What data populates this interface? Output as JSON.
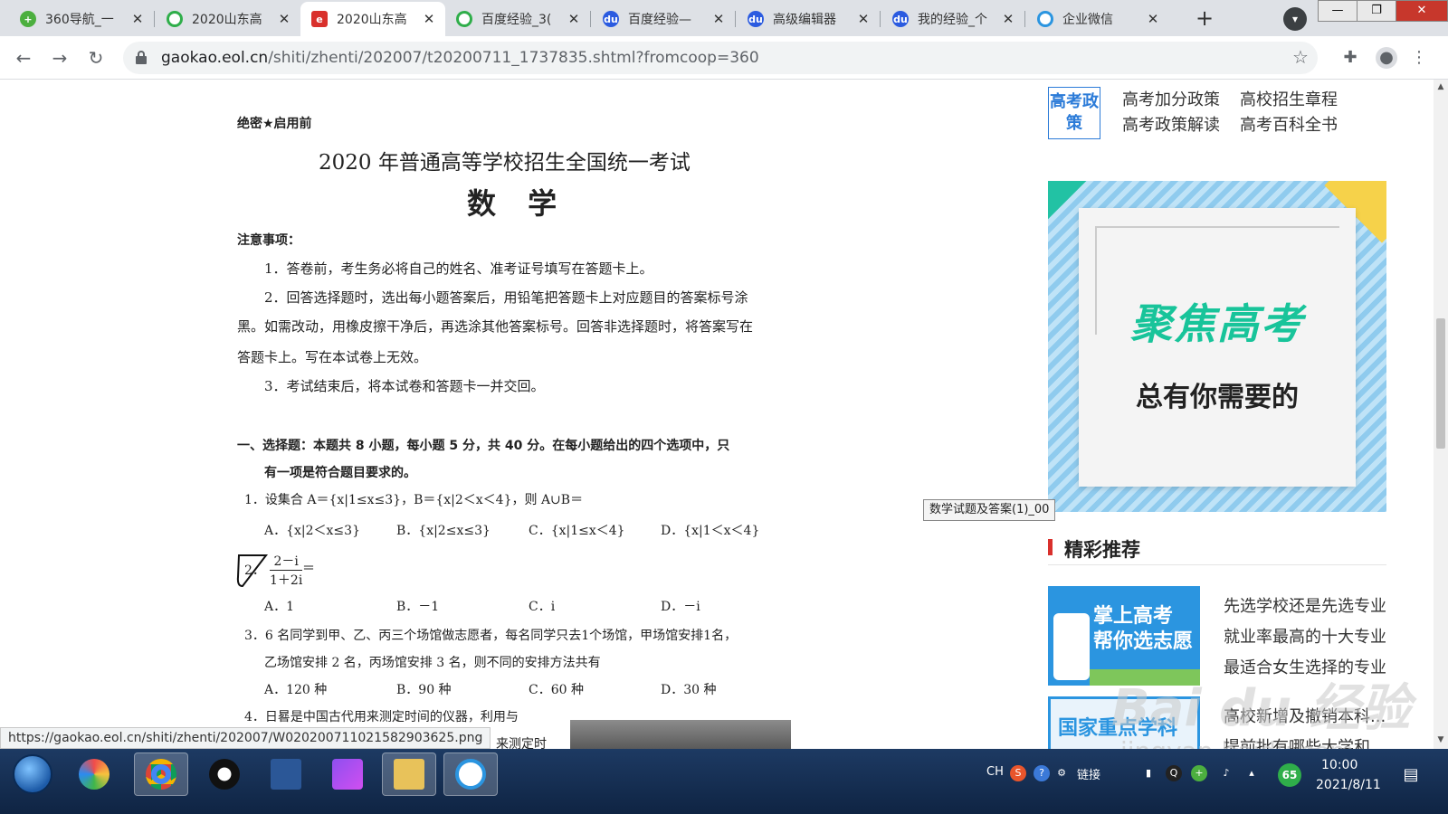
{
  "browser": {
    "tabs": [
      {
        "label": "360导航_一",
        "icon": "360",
        "color": "#4caf3f",
        "active": false
      },
      {
        "label": "2020山东高",
        "icon": "O",
        "color": "#2fae4a",
        "active": false
      },
      {
        "label": "2020山东高",
        "icon": "E",
        "color": "#d9302c",
        "active": true
      },
      {
        "label": "百度经验_3(",
        "icon": "O",
        "color": "#2fae4a",
        "active": false
      },
      {
        "label": "百度经验—",
        "icon": "du",
        "color": "#2b5be0",
        "active": false
      },
      {
        "label": "高级编辑器",
        "icon": "du",
        "color": "#2b5be0",
        "active": false
      },
      {
        "label": "我的经验_个",
        "icon": "du",
        "color": "#2b5be0",
        "active": false
      },
      {
        "label": "企业微信",
        "icon": "wx",
        "color": "#2b95e0",
        "active": false
      }
    ],
    "tab_close": "✕",
    "new_tab": "+",
    "url_host": "gaokao.eol.cn",
    "url_path": "/shiti/zhenti/202007/t20200711_1737835.shtml?fromcoop=360",
    "window_controls": {
      "minimize": "—",
      "maximize": "❐",
      "close": "✕"
    }
  },
  "paper": {
    "secret": "绝密★启用前",
    "title": "2020 年普通高等学校招生全国统一考试",
    "subject": "数 学",
    "notice_heading": "注意事项：",
    "notices": [
      "1．答卷前，考生务必将自己的姓名、准考证号填写在答题卡上。",
      "2．回答选择题时，选出每小题答案后，用铅笔把答题卡上对应题目的答案标号涂",
      "黑。如需改动，用橡皮擦干净后，再选涂其他答案标号。回答非选择题时，将答案写在",
      "答题卡上。写在本试卷上无效。",
      "3．考试结束后，将本试卷和答题卡一并交回。"
    ],
    "section1_line1": "一、选择题：本题共 8 小题，每小题 5 分，共 40 分。在每小题给出的四个选项中，只",
    "section1_line2": "有一项是符合题目要求的。",
    "q1": "1．设集合 A＝{x|1≤x≤3}，B＝{x|2＜x＜4}，则 A∪B＝",
    "q1_options": [
      "A．{x|2＜x≤3}",
      "B．{x|2≤x≤3}",
      "C．{x|1≤x＜4}",
      "D．{x|1＜x＜4}"
    ],
    "q2_number": "2．",
    "q2_num": "2－i",
    "q2_den": "1＋2i",
    "q2_eq": "＝",
    "q2_options": [
      "A．1",
      "B．－1",
      "C．i",
      "D．－i"
    ],
    "q3_line1": "3．6 名同学到甲、乙、丙三个场馆做志愿者，每名同学只去1个场馆，甲场馆安排1名，",
    "q3_line2": "乙场馆安排 2 名，丙场馆安排 3 名，则不同的安排方法共有",
    "q3_options": [
      "A．120 种",
      "B．90 种",
      "C．60 种",
      "D．30 种"
    ],
    "q4_line1": "4．日晷是中国古代用来测定时间的仪器，利用与",
    "q4_line2": "来测定时"
  },
  "sidebar": {
    "policy_box": "高考政策",
    "policy_links": [
      "高考加分政策",
      "高校招生章程",
      "高考政策解读",
      "高考百科全书"
    ],
    "banner_title": "聚焦高考",
    "banner_sub": "总有你需要的",
    "tooltip": "数学试题及答案(1)_00",
    "rec_title": "精彩推荐",
    "promo1_text1": "掌上高考",
    "promo1_text2": "帮你选志愿",
    "promo2_text": "国家重点学科",
    "rec_items": [
      "先选学校还是先选专业",
      "就业率最高的十大专业",
      "最适合女生选择的专业",
      "高校新增及撤销本科...",
      "提前批有哪些大学和"
    ],
    "watermark1": "Bai du 经验",
    "watermark2": "jingyan.baidu.com"
  },
  "status_url": "https://gaokao.eol.cn/shiti/zhenti/202007/W020200711021582903625.png",
  "taskbar": {
    "tray_lang": "CH",
    "tray_link": "链接",
    "badge": "65",
    "time": "10:00",
    "date": "2021/8/11"
  }
}
